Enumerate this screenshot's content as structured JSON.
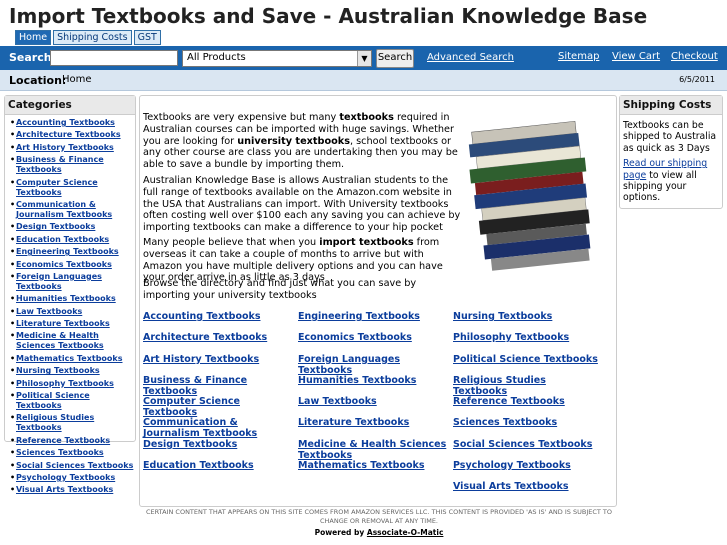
{
  "header": {
    "title": "Import Textbooks and Save - Australian Knowledge Base"
  },
  "tabs": [
    "Home",
    "Shipping Costs",
    "GST"
  ],
  "search": {
    "label": "Search",
    "placeholder": "",
    "category": "All Products",
    "button": "Search",
    "advanced": "Advanced Search"
  },
  "nav_links": [
    "Sitemap",
    "View Cart",
    "Checkout"
  ],
  "location": {
    "label": "Location:",
    "value": "Home",
    "date": "6/5/2011"
  },
  "categories": {
    "heading": "Categories",
    "items": [
      "Accounting Textbooks",
      "Architecture Textbooks",
      "Art History Textbooks",
      "Business & Finance Textbooks",
      "Computer Science Textbooks",
      "Communication & Journalism Textbooks",
      "Design Textbooks",
      "Education Textbooks",
      "Engineering Textbooks",
      "Economics Textbooks",
      "Foreign Languages Textbooks",
      "Humanities Textbooks",
      "Law Textbooks",
      "Literature Textbooks",
      "Medicine & Health Sciences Textbooks",
      "Mathematics Textbooks",
      "Nursing Textbooks",
      "Philosophy Textbooks",
      "Political Science Textbooks",
      "Religious Studies Textbooks",
      "Reference Textbooks",
      "Sciences Textbooks",
      "Social Sciences Textbooks",
      "Psychology Textbooks",
      "Visual Arts Textbooks"
    ]
  },
  "main": {
    "p1": {
      "a": "Textbooks are very expensive but many ",
      "b": "textbooks",
      "c": " required in Australian courses can be imported with huge savings. Whether you are looking for ",
      "d": "university textbooks",
      "e": ", school textbooks or any other course are class you are undertaking then you may be able to save a bundle by importing them."
    },
    "p2": "Australian Knowledge Base is allows Australian students to the full range of textbooks available on the Amazon.com website in the USA that Australians can import. With University textbooks often costing well over $100 each any saving you can achieve by importing textbooks can make a difference to your hip pocket",
    "p3": {
      "a": "Many people believe that when you ",
      "b": "import textbooks",
      "c": " from overseas it can take a couple of months to arrive but with Amazon you have multiple delivery options and you can have your order arrive in as little as 3 days"
    },
    "p4": "Browse the directory and find just what you can save by importing your university textbooks",
    "col1": [
      "Accounting Textbooks",
      "Architecture Textbooks",
      "Art History Textbooks",
      "Business & Finance Textbooks",
      "Computer Science Textbooks",
      "Communication & Journalism Textbooks",
      "Design Textbooks",
      "Education Textbooks"
    ],
    "col2": [
      "Engineering Textbooks",
      "Economics Textbooks",
      "Foreign Languages Textbooks",
      "Humanities Textbooks",
      "Law Textbooks",
      "Literature Textbooks",
      "Medicine & Health Sciences Textbooks",
      "Mathematics Textbooks"
    ],
    "col3": [
      "Nursing Textbooks",
      "Philosophy Textbooks",
      "Political Science Textbooks",
      "Religious Studies Textbooks",
      "Reference Textbooks",
      "Sciences Textbooks",
      "Social Sciences Textbooks",
      "Psychology Textbooks",
      "Visual Arts Textbooks"
    ]
  },
  "shipping": {
    "heading": "Shipping Costs",
    "text": "Textbooks can be shipped to Australia as quick as 3 Days",
    "link": "Read our shipping page",
    "rest": " to view all shipping your options."
  },
  "footer": {
    "disclaimer": "CERTAIN CONTENT THAT APPEARS ON THIS SITE COMES FROM AMAZON SERVICES LLC. THIS CONTENT IS PROVIDED 'AS IS' AND IS SUBJECT TO CHANGE OR REMOVAL AT ANY TIME.",
    "powered": "Powered by ",
    "powered_link": "Associate-O-Matic"
  }
}
